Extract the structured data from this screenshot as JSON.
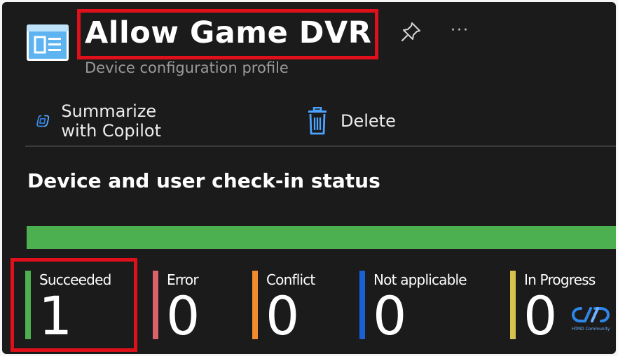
{
  "header": {
    "title": "Allow Game DVR",
    "subtitle": "Device configuration profile",
    "more_label": "···"
  },
  "toolbar": {
    "copilot_label": "Summarize with Copilot",
    "delete_label": "Delete"
  },
  "section": {
    "title": "Device and user check-in status"
  },
  "progress": {
    "succeeded_fraction": 1.0,
    "fill_color": "#4caf50"
  },
  "stats": [
    {
      "label": "Succeeded",
      "value": "1",
      "color": "#4caf50"
    },
    {
      "label": "Error",
      "value": "0",
      "color": "#d9626b"
    },
    {
      "label": "Conflict",
      "value": "0",
      "color": "#f28a2e"
    },
    {
      "label": "Not applicable",
      "value": "0",
      "color": "#1a5fd6"
    },
    {
      "label": "In Progress",
      "value": "0",
      "color": "#d8c24e"
    }
  ],
  "watermark": {
    "text": "HTMD Community"
  },
  "colors": {
    "highlight": "#e0101b",
    "background": "#1b1b1b",
    "accent": "#4ba3ff"
  },
  "icons": {
    "app": "config-profile-icon",
    "pin": "pin-icon",
    "copilot": "copilot-icon",
    "delete": "trash-icon"
  }
}
